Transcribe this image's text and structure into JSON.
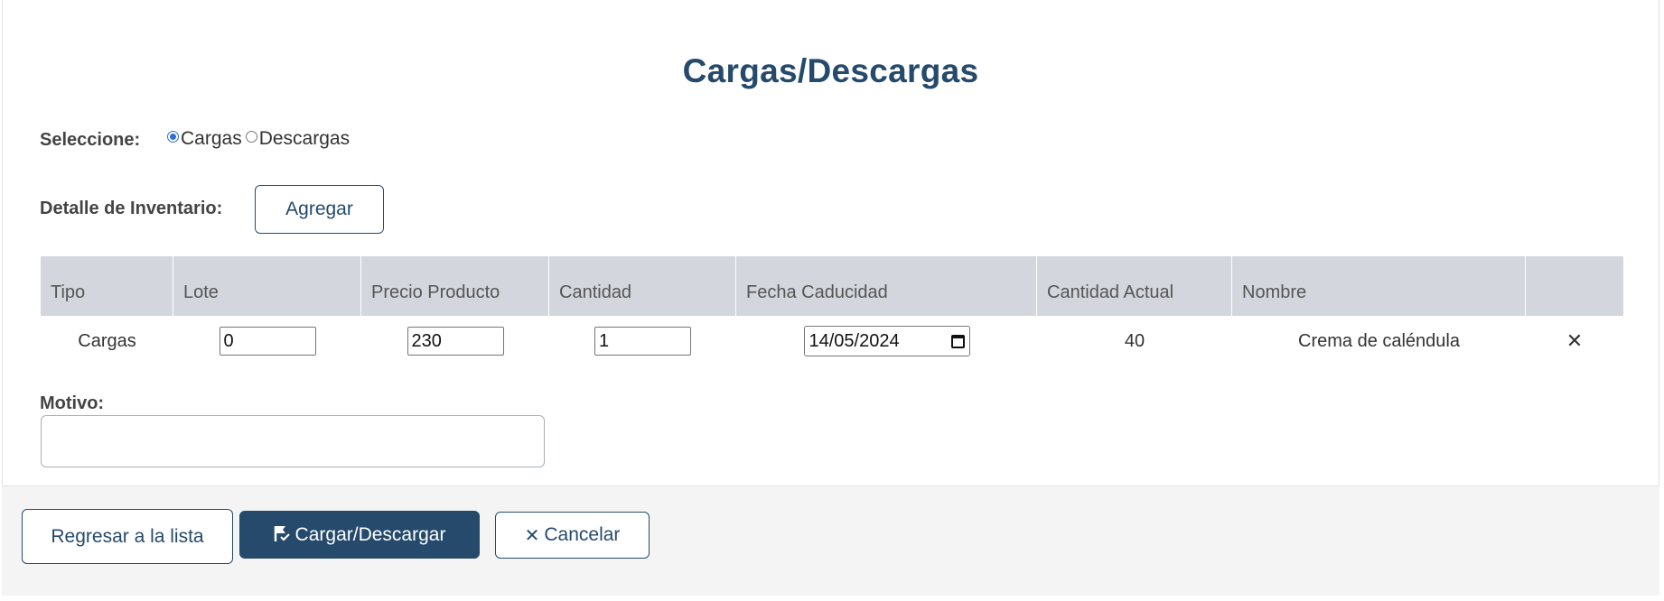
{
  "page": {
    "title": "Cargas/Descargas"
  },
  "selection": {
    "label": "Seleccione:",
    "options": [
      {
        "label": "Cargas",
        "checked": true
      },
      {
        "label": "Descargas",
        "checked": false
      }
    ]
  },
  "inventory": {
    "label": "Detalle de Inventario:",
    "add_button": "Agregar"
  },
  "table": {
    "columns": [
      "Tipo",
      "Lote",
      "Precio Producto",
      "Cantidad",
      "Fecha Caducidad",
      "Cantidad Actual",
      "Nombre",
      ""
    ],
    "rows": [
      {
        "tipo": "Cargas",
        "lote": "0",
        "precio": "230",
        "cantidad": "1",
        "fecha": "14/05/2024",
        "cantidad_actual": "40",
        "nombre": "Crema de caléndula",
        "remove_icon": "close-icon"
      }
    ]
  },
  "motivo": {
    "label": "Motivo:",
    "value": ""
  },
  "footer": {
    "back_button": "Regresar a la lista",
    "submit_button": "Cargar/Descargar",
    "cancel_button": "Cancelar"
  },
  "colors": {
    "primary": "#254a6c",
    "header_bg": "#d3d6dc",
    "footer_bg": "#f4f4f4",
    "radio_accent": "#2d6fd3"
  }
}
